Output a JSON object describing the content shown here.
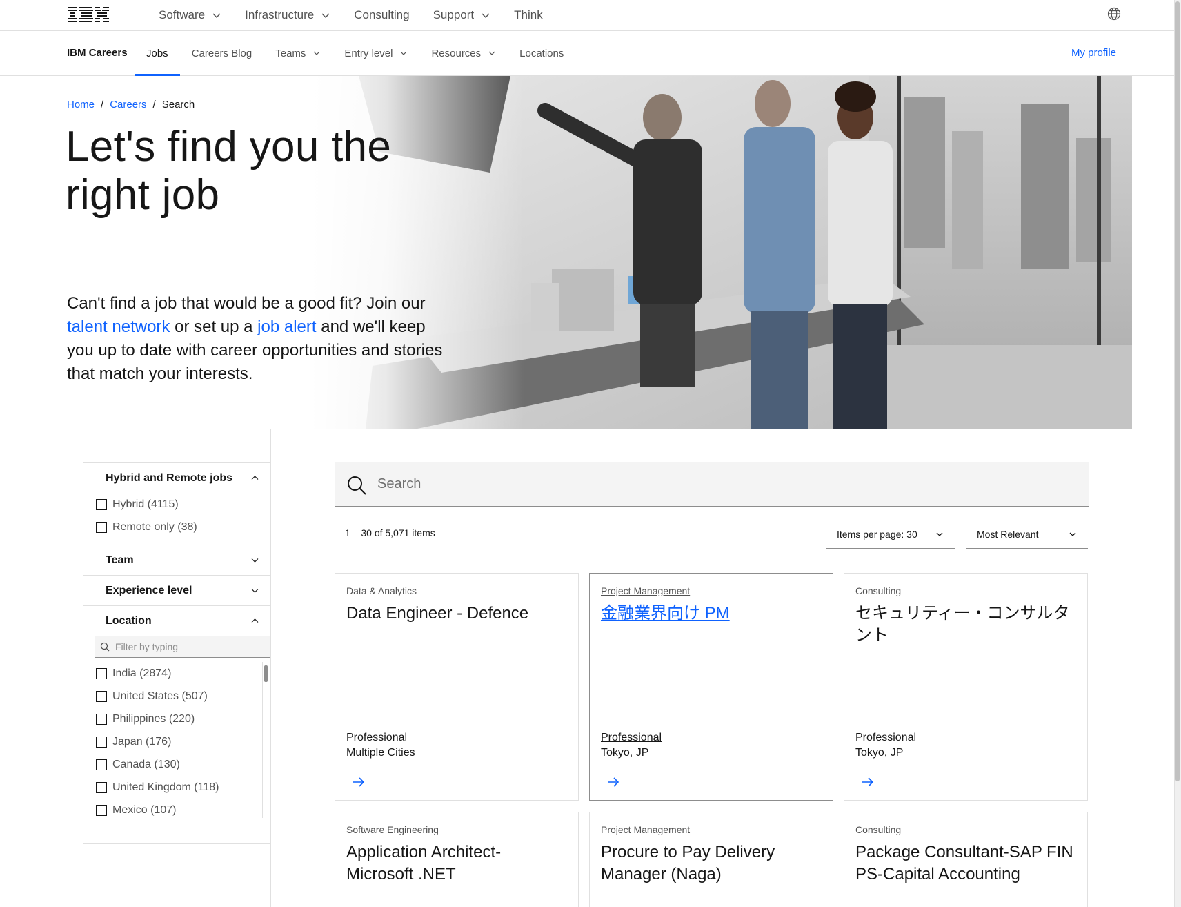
{
  "masthead": {
    "logo_text": "IBM",
    "nav": [
      {
        "label": "Software",
        "has_menu": true
      },
      {
        "label": "Infrastructure",
        "has_menu": true
      },
      {
        "label": "Consulting",
        "has_menu": false
      },
      {
        "label": "Support",
        "has_menu": true
      },
      {
        "label": "Think",
        "has_menu": false
      }
    ],
    "globe_icon": "globe-icon"
  },
  "subnav": {
    "brand": "IBM Careers",
    "items": [
      {
        "label": "Jobs",
        "active": true
      },
      {
        "label": "Careers Blog"
      },
      {
        "label": "Teams",
        "has_menu": true
      },
      {
        "label": "Entry level",
        "has_menu": true
      },
      {
        "label": "Resources",
        "has_menu": true
      },
      {
        "label": "Locations"
      }
    ],
    "my_profile": "My profile"
  },
  "breadcrumb": {
    "home": "Home",
    "careers": "Careers",
    "current": "Search",
    "separator": "/"
  },
  "hero": {
    "title": "Let's find you the right job",
    "text_1": "Can't find a job that would be a good fit? Join our ",
    "link_talent": "talent network",
    "text_2": " or set up a ",
    "link_alert": "job alert",
    "text_3": " and we'll keep you up to date with career opportunities and stories that match your interests."
  },
  "filters": {
    "hybrid_section": {
      "title": "Hybrid and Remote jobs",
      "expanded": true,
      "options": [
        "Hybrid (4115)",
        "Remote only (38)"
      ]
    },
    "team_section": {
      "title": "Team",
      "expanded": false
    },
    "experience_section": {
      "title": "Experience level",
      "expanded": false
    },
    "location_section": {
      "title": "Location",
      "expanded": true,
      "filter_placeholder": "Filter by typing",
      "options": [
        "India (2874)",
        "United States (507)",
        "Philippines (220)",
        "Japan (176)",
        "Canada (130)",
        "United Kingdom (118)",
        "Mexico (107)"
      ]
    }
  },
  "search": {
    "placeholder": "Search",
    "value": ""
  },
  "results": {
    "count_text": "1 – 30 of 5,071 items",
    "per_page": "Items per page: 30",
    "sort": "Most Relevant"
  },
  "jobs": [
    {
      "category": "Data & Analytics",
      "title": "Data Engineer - Defence",
      "level": "Professional",
      "location": "Multiple Cities"
    },
    {
      "category": "Project Management",
      "title": "金融業界向け PM",
      "level": "Professional",
      "location": "Tokyo, JP",
      "hovered": true
    },
    {
      "category": "Consulting",
      "title": "セキュリティー・コンサルタント",
      "level": "Professional",
      "location": "Tokyo, JP"
    },
    {
      "category": "Software Engineering",
      "title": "Application Architect- Microsoft .NET",
      "level": "",
      "location": ""
    },
    {
      "category": "Project Management",
      "title": "Procure to Pay Delivery Manager (Naga)",
      "level": "",
      "location": ""
    },
    {
      "category": "Consulting",
      "title": "Package Consultant-SAP FIN PS-Capital Accounting",
      "level": "",
      "location": ""
    }
  ],
  "colors": {
    "accent": "#0f62fe",
    "text": "#161616",
    "secondary_text": "#525252",
    "border": "#e0e0e0",
    "field_bg": "#f4f4f4"
  }
}
